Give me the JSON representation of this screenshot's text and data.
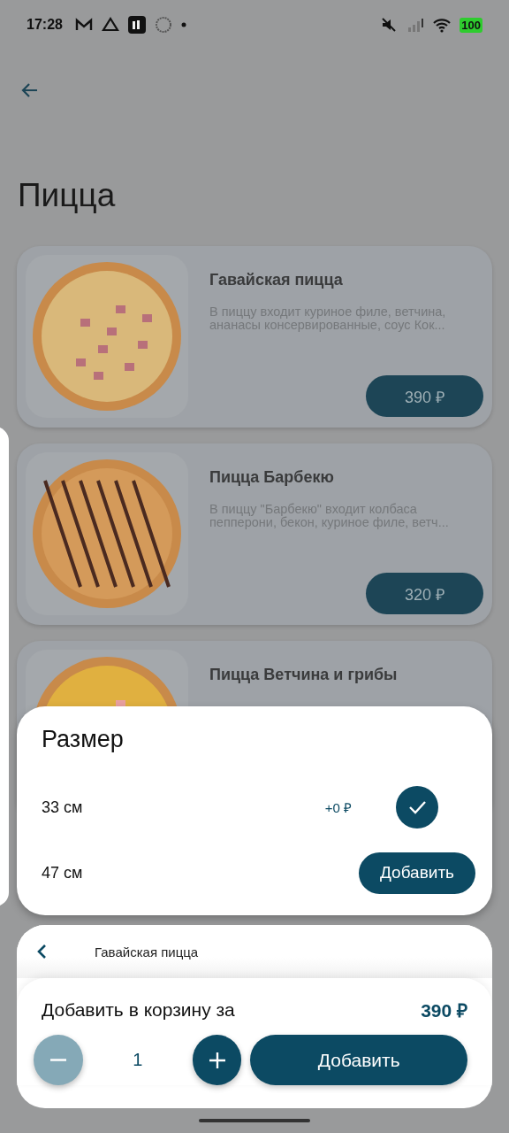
{
  "status_bar": {
    "time": "17:28",
    "battery": "100"
  },
  "page": {
    "title": "Пицца"
  },
  "products": [
    {
      "name": "Гавайская пицца",
      "description": "В пиццу входит куриное филе, ветчина, ананасы консервированные, соус Кок...",
      "price": "390 ₽",
      "kind": "ham"
    },
    {
      "name": "Пицца Барбекю",
      "description": "В пиццу \"Барбекю\" входит колбаса пепперони, бекон, куриное филе, ветч...",
      "price": "320 ₽",
      "kind": "bbq"
    },
    {
      "name": "Пицца Ветчина и грибы",
      "kind": "cheese"
    }
  ],
  "size_sheet": {
    "title": "Размер",
    "options": [
      {
        "label": "33 см",
        "selected": true,
        "extra_price": "+0 ₽"
      },
      {
        "label": "47 см",
        "selected": false,
        "add_label": "Добавить"
      }
    ]
  },
  "cart_sheet": {
    "product_name": "Гавайская пицца",
    "total_label": "Добавить в корзину за",
    "total_price": "390 ₽",
    "quantity": "1",
    "decrease_disabled": true,
    "add_label": "Добавить"
  }
}
